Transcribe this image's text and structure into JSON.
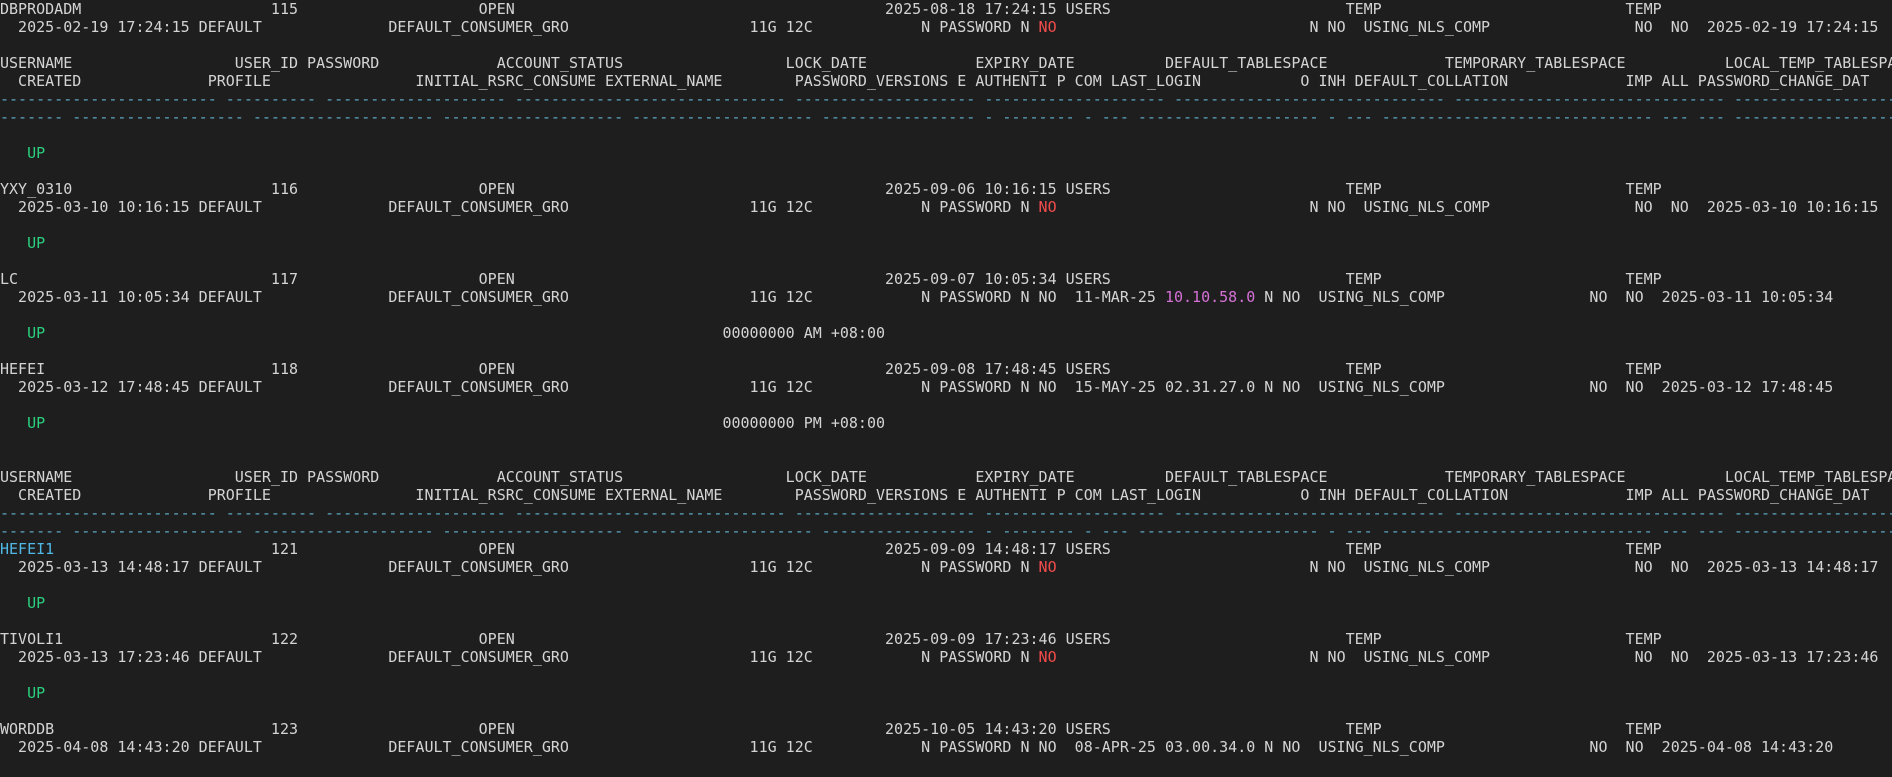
{
  "colors": {
    "background": "#1e1e1e",
    "text": "#d4d4d4",
    "dash": "#5fa9c4",
    "green": "#2bd17e",
    "red": "#f14c4c",
    "magenta": "#d670d6",
    "cyan": "#4fb8e6"
  },
  "lines": [
    [
      {
        "t": "DBPRODADM                     115                    OPEN                                         2025-08-18 17:24:15 USERS                          TEMP                           TEMP"
      }
    ],
    [
      {
        "t": "  2025-02-19 17:24:15 DEFAULT              DEFAULT_CONSUMER_GRO                    11G 12C            N PASSWORD N "
      },
      {
        "t": "NO",
        "c": "red"
      },
      {
        "t": "                            N NO  USING_NLS_COMP                NO  NO  2025-02-19 17:24:15"
      }
    ],
    [
      {
        "t": ""
      }
    ],
    [
      {
        "t": "USERNAME                  USER_ID PASSWORD             ACCOUNT_STATUS                  LOCK_DATE            EXPIRY_DATE          DEFAULT_TABLESPACE             TEMPORARY_TABLESPACE           LOCAL_TEMP_TABLESPACE"
      }
    ],
    [
      {
        "t": "  CREATED              PROFILE                INITIAL_RSRC_CONSUME EXTERNAL_NAME        PASSWORD_VERSIONS E AUTHENTI P COM LAST_LOGIN           O INH DEFAULT_COLLATION             IMP ALL PASSWORD_CHANGE_DAT"
      }
    ],
    [
      {
        "t": "------------------------ ---------- -------------------- ------------------------------ -------------------- -------------------- ------------------------------ ------------------------------ --------------------------------",
        "c": "dash"
      }
    ],
    [
      {
        "t": "------- ------------------- -------------------- -------------------- -------------------- ----------------- - -------- - --- -------------------- - --- ------------------------------ --- --- ----------------------",
        "c": "dash"
      }
    ],
    [
      {
        "t": ""
      }
    ],
    [
      {
        "t": "   "
      },
      {
        "t": "UP",
        "c": "green"
      }
    ],
    [
      {
        "t": ""
      }
    ],
    [
      {
        "t": "YXY_0310                      116                    OPEN                                         2025-09-06 10:16:15 USERS                          TEMP                           TEMP"
      }
    ],
    [
      {
        "t": "  2025-03-10 10:16:15 DEFAULT              DEFAULT_CONSUMER_GRO                    11G 12C            N PASSWORD N "
      },
      {
        "t": "NO",
        "c": "red"
      },
      {
        "t": "                            N NO  USING_NLS_COMP                NO  NO  2025-03-10 10:16:15"
      }
    ],
    [
      {
        "t": ""
      }
    ],
    [
      {
        "t": "   "
      },
      {
        "t": "UP",
        "c": "green"
      }
    ],
    [
      {
        "t": ""
      }
    ],
    [
      {
        "t": "LC                            117                    OPEN                                         2025-09-07 10:05:34 USERS                          TEMP                           TEMP"
      }
    ],
    [
      {
        "t": "  2025-03-11 10:05:34 DEFAULT              DEFAULT_CONSUMER_GRO                    11G 12C            N PASSWORD N NO  11-MAR-25 "
      },
      {
        "t": "10.10.58.0",
        "c": "magenta"
      },
      {
        "t": " N NO  USING_NLS_COMP                NO  NO  2025-03-11 10:05:34"
      }
    ],
    [
      {
        "t": ""
      }
    ],
    [
      {
        "t": "   "
      },
      {
        "t": "UP",
        "c": "green"
      },
      {
        "t": "                                                                           00000000 AM +08:00"
      }
    ],
    [
      {
        "t": ""
      }
    ],
    [
      {
        "t": "HEFEI                         118                    OPEN                                         2025-09-08 17:48:45 USERS                          TEMP                           TEMP"
      }
    ],
    [
      {
        "t": "  2025-03-12 17:48:45 DEFAULT              DEFAULT_CONSUMER_GRO                    11G 12C            N PASSWORD N NO  15-MAY-25 02.31.27.0 N NO  USING_NLS_COMP                NO  NO  2025-03-12 17:48:45"
      }
    ],
    [
      {
        "t": ""
      }
    ],
    [
      {
        "t": "   "
      },
      {
        "t": "UP",
        "c": "green"
      },
      {
        "t": "                                                                           00000000 PM +08:00"
      }
    ],
    [
      {
        "t": ""
      }
    ],
    [
      {
        "t": ""
      }
    ],
    [
      {
        "t": "USERNAME                  USER_ID PASSWORD             ACCOUNT_STATUS                  LOCK_DATE            EXPIRY_DATE          DEFAULT_TABLESPACE             TEMPORARY_TABLESPACE           LOCAL_TEMP_TABLESPACE"
      }
    ],
    [
      {
        "t": "  CREATED              PROFILE                INITIAL_RSRC_CONSUME EXTERNAL_NAME        PASSWORD_VERSIONS E AUTHENTI P COM LAST_LOGIN           O INH DEFAULT_COLLATION             IMP ALL PASSWORD_CHANGE_DAT"
      }
    ],
    [
      {
        "t": "------------------------ ---------- -------------------- ------------------------------ -------------------- -------------------- ------------------------------ ------------------------------ --------------------------------",
        "c": "dash"
      }
    ],
    [
      {
        "t": "------- ------------------- -------------------- -------------------- -------------------- ----------------- - -------- - --- -------------------- - --- ------------------------------ --- --- ----------------------",
        "c": "dash"
      }
    ],
    [
      {
        "t": "HEFEI1",
        "c": "cyan"
      },
      {
        "t": "                        121                    OPEN                                         2025-09-09 14:48:17 USERS                          TEMP                           TEMP"
      }
    ],
    [
      {
        "t": "  2025-03-13 14:48:17 DEFAULT              DEFAULT_CONSUMER_GRO                    11G 12C            N PASSWORD N "
      },
      {
        "t": "NO",
        "c": "red"
      },
      {
        "t": "                            N NO  USING_NLS_COMP                NO  NO  2025-03-13 14:48:17"
      }
    ],
    [
      {
        "t": ""
      }
    ],
    [
      {
        "t": "   "
      },
      {
        "t": "UP",
        "c": "green"
      }
    ],
    [
      {
        "t": ""
      }
    ],
    [
      {
        "t": "TIVOLI1                       122                    OPEN                                         2025-09-09 17:23:46 USERS                          TEMP                           TEMP"
      }
    ],
    [
      {
        "t": "  2025-03-13 17:23:46 DEFAULT              DEFAULT_CONSUMER_GRO                    11G 12C            N PASSWORD N "
      },
      {
        "t": "NO",
        "c": "red"
      },
      {
        "t": "                            N NO  USING_NLS_COMP                NO  NO  2025-03-13 17:23:46"
      }
    ],
    [
      {
        "t": ""
      }
    ],
    [
      {
        "t": "   "
      },
      {
        "t": "UP",
        "c": "green"
      }
    ],
    [
      {
        "t": ""
      }
    ],
    [
      {
        "t": "WORDDB                        123                    OPEN                                         2025-10-05 14:43:20 USERS                          TEMP                           TEMP"
      }
    ],
    [
      {
        "t": "  2025-04-08 14:43:20 DEFAULT              DEFAULT_CONSUMER_GRO                    11G 12C            N PASSWORD N NO  08-APR-25 03.00.34.0 N NO  USING_NLS_COMP                NO  NO  2025-04-08 14:43:20"
      }
    ],
    [
      {
        "t": ""
      }
    ]
  ]
}
